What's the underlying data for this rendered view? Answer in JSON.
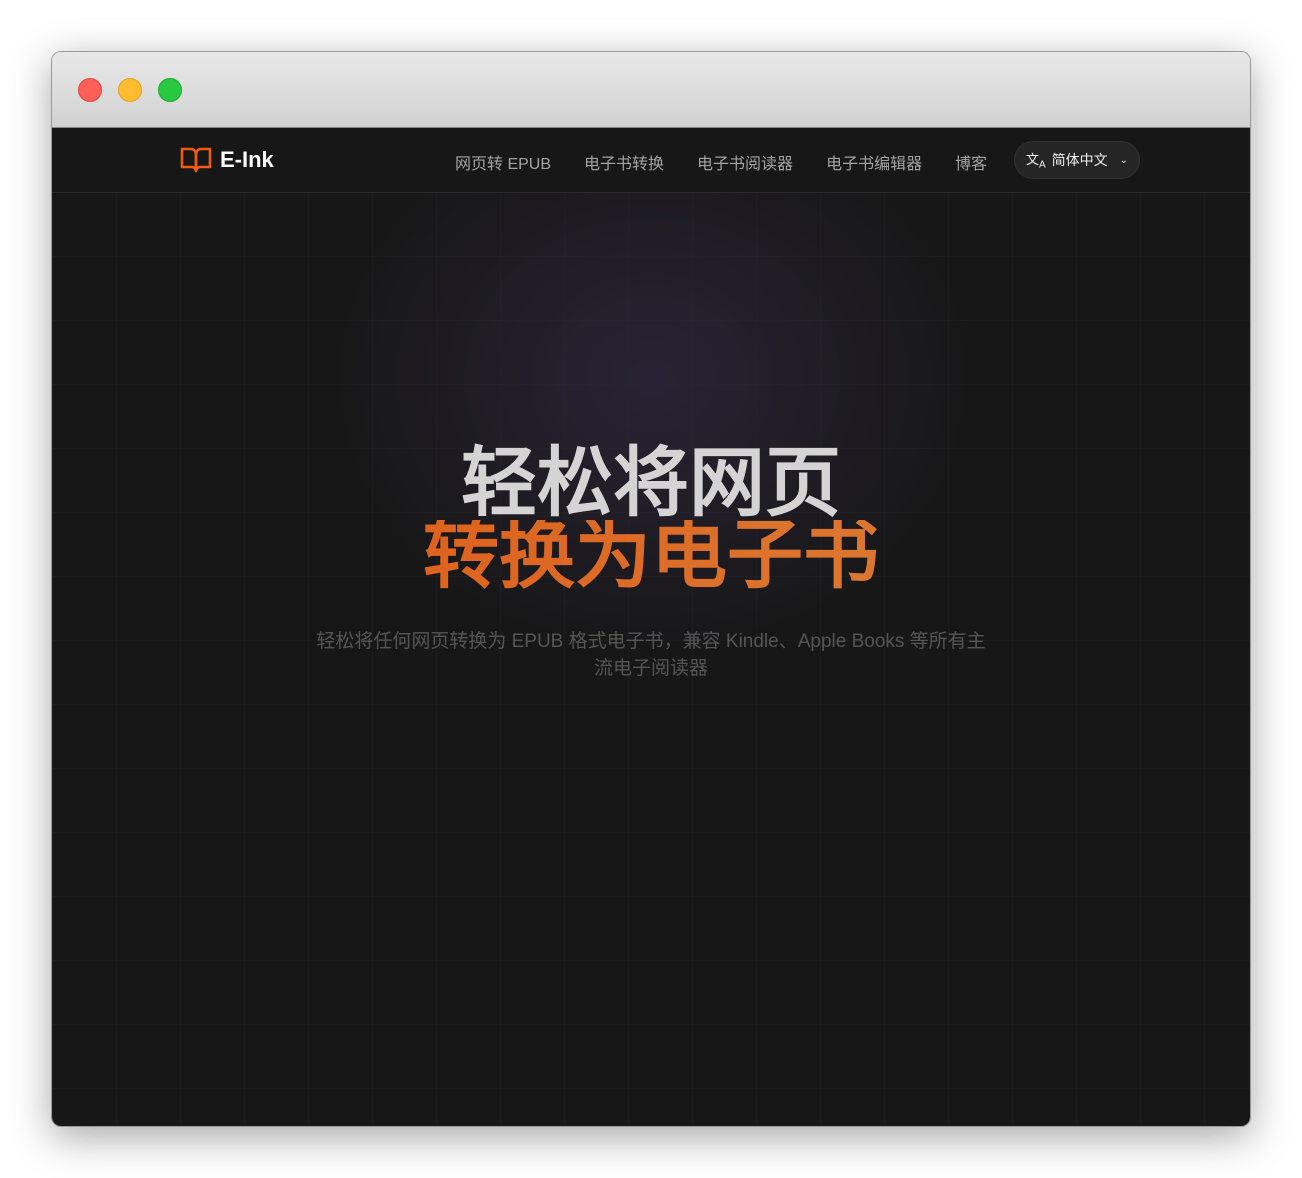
{
  "brand": {
    "name": "E-Ink",
    "accent": "#f05a12"
  },
  "nav": {
    "items": [
      "网页转 EPUB",
      "电子书转换",
      "电子书阅读器",
      "电子书编辑器",
      "博客"
    ],
    "language": "简体中文"
  },
  "hero": {
    "title_line1": "轻松将网页",
    "title_line2": "转换为电子书",
    "subtitle": "轻松将任何网页转换为 EPUB 格式电子书，兼容 Kindle、Apple Books 等所有主流电子阅读器"
  }
}
